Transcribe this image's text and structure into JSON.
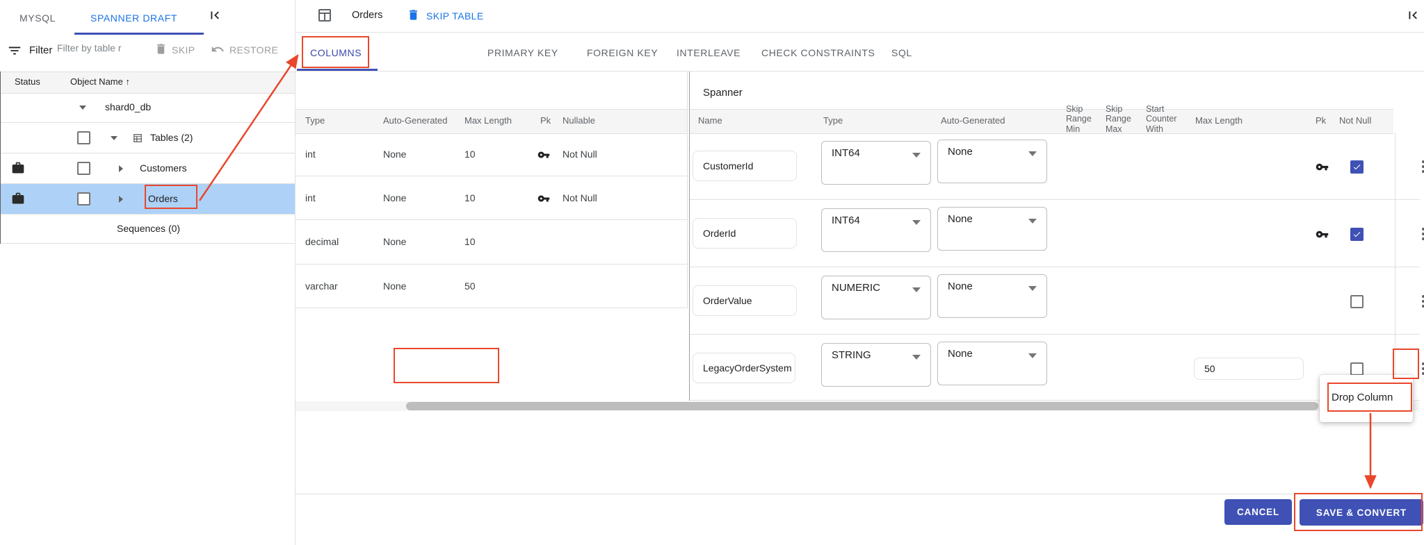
{
  "colors": {
    "accent_blue": "#1a73e8",
    "indigo": "#3f51b5",
    "annotation_red": "#e8472b",
    "selected_row_bg": "#aed2f7",
    "header_bg": "#f5f5f5",
    "border": "#e0e0e0",
    "text_secondary": "#5f6368"
  },
  "left_panel": {
    "tabs": [
      {
        "label": "MYSQL"
      },
      {
        "label": "SPANNER DRAFT"
      }
    ],
    "active_tab": "SPANNER DRAFT",
    "collapse_icon": "first-page",
    "filter": {
      "label": "Filter",
      "placeholder": "Filter by table r"
    },
    "actions": {
      "skip": "SKIP",
      "restore": "RESTORE"
    },
    "tree": {
      "headers": {
        "status": "Status",
        "object_name": "Object Name",
        "sort": "↑"
      },
      "rows": [
        {
          "label": "shard0_db"
        },
        {
          "label": "Tables (2)"
        },
        {
          "label": "Customers"
        },
        {
          "label": "Orders",
          "selected": true
        },
        {
          "label": "Sequences (0)"
        }
      ]
    }
  },
  "main": {
    "title": "Orders",
    "skip_table_label": "SKIP TABLE",
    "tabs": [
      "COLUMNS",
      "PRIMARY KEY",
      "FOREIGN KEY",
      "INTERLEAVE",
      "CHECK CONSTRAINTS",
      "SQL"
    ],
    "active_tab": "COLUMNS",
    "source_table": {
      "headers": [
        "Type",
        "Auto-Generated",
        "Max Length",
        "Pk",
        "Nullable"
      ],
      "rows": [
        {
          "type": "int",
          "auto": "None",
          "max": "10",
          "pk": true,
          "nullable": "Not Null"
        },
        {
          "type": "int",
          "auto": "None",
          "max": "10",
          "pk": true,
          "nullable": "Not Null"
        },
        {
          "type": "decimal",
          "auto": "None",
          "max": "10",
          "pk": false,
          "nullable": ""
        },
        {
          "type": "varchar",
          "auto": "None",
          "max": "50",
          "pk": false,
          "nullable": ""
        }
      ]
    },
    "spanner_table": {
      "title": "Spanner",
      "headers": [
        "Name",
        "Type",
        "Auto-Generated",
        "Skip Range Min",
        "Skip Range Max",
        "Start Counter With",
        "Max Length",
        "Pk",
        "Not Null"
      ],
      "rows": [
        {
          "name": "CustomerId",
          "type": "INT64",
          "auto": "None",
          "max": "",
          "pk": true,
          "not_null": true
        },
        {
          "name": "OrderId",
          "type": "INT64",
          "auto": "None",
          "max": "",
          "pk": true,
          "not_null": true
        },
        {
          "name": "OrderValue",
          "type": "NUMERIC",
          "auto": "None",
          "max": "",
          "pk": false,
          "not_null": false
        },
        {
          "name": "LegacyOrderSystem",
          "type": "STRING",
          "auto": "None",
          "max": "50",
          "pk": false,
          "not_null": false
        }
      ]
    },
    "context_menu": {
      "drop_column": "Drop Column"
    },
    "footer_buttons": {
      "cancel": "CANCEL",
      "save": "SAVE & CONVERT"
    }
  }
}
